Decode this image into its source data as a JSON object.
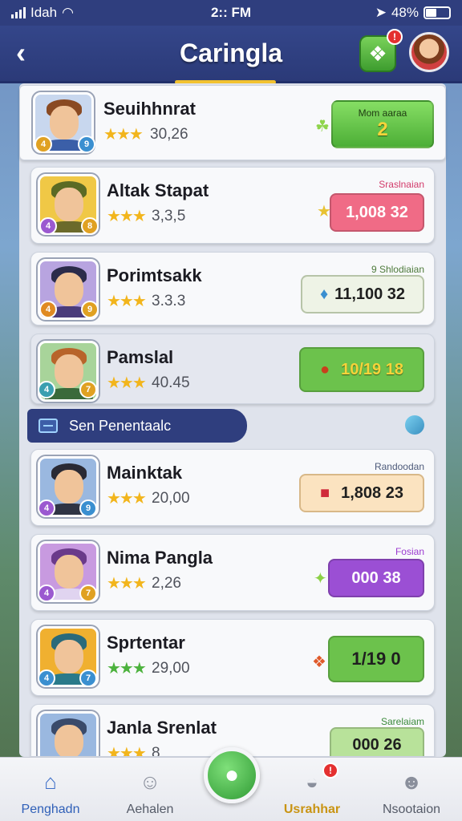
{
  "status_bar": {
    "carrier": "Idah",
    "time": "2:: FM",
    "battery_percent": "48%"
  },
  "header": {
    "title": "Caringla",
    "back_icon": "chevron-left-icon",
    "puzzle_badge": "!"
  },
  "top_card": {
    "name": "Seuihhnrat",
    "rating": "30,26",
    "button_label": "Mom aaraa",
    "button_value": "2"
  },
  "rows": [
    {
      "name": "Altak Stapat",
      "rating": "3,3,5",
      "tag": "Sraslnaian",
      "value": "1,008 32",
      "color": "#f06b86"
    },
    {
      "name": "Porimtsakk",
      "rating": "3.3.3",
      "tag": "9 Shlodiaian",
      "value": "11,100 32",
      "color": "#eef3e6"
    },
    {
      "name": "Pamslal",
      "rating": "40.45",
      "tag": "",
      "value": "10/19 18",
      "color": "#6cc24c"
    }
  ],
  "section": {
    "label": "Sen Penentaalc"
  },
  "rows2": [
    {
      "name": "Mainktak",
      "rating": "20,00",
      "tag": "Randoodan",
      "value": "1,808 23",
      "color": "#fbe3c0"
    },
    {
      "name": "Nima Pangla",
      "rating": "2,26",
      "tag": "Fosian",
      "value": "000 38",
      "color": "#9b4fd4"
    },
    {
      "name": "Sprtentar",
      "rating": "29,00",
      "tag": "",
      "value": "1/19 0",
      "color": "#6cc24c"
    },
    {
      "name": "Janla Srenlat",
      "rating": "8",
      "tag": "Sarelaiam",
      "value": "000 26",
      "color": "#b8e29a"
    }
  ],
  "bottom_nav": [
    {
      "label": "Penghadn",
      "icon": "home-icon"
    },
    {
      "label": "Aehalen",
      "icon": "person-icon"
    },
    {
      "label": "",
      "icon": "chat-bubble-icon"
    },
    {
      "label": "Usrahhar",
      "icon": "helmet-icon",
      "badge": "!"
    },
    {
      "label": "Nsootaion",
      "icon": "profile-icon"
    }
  ]
}
